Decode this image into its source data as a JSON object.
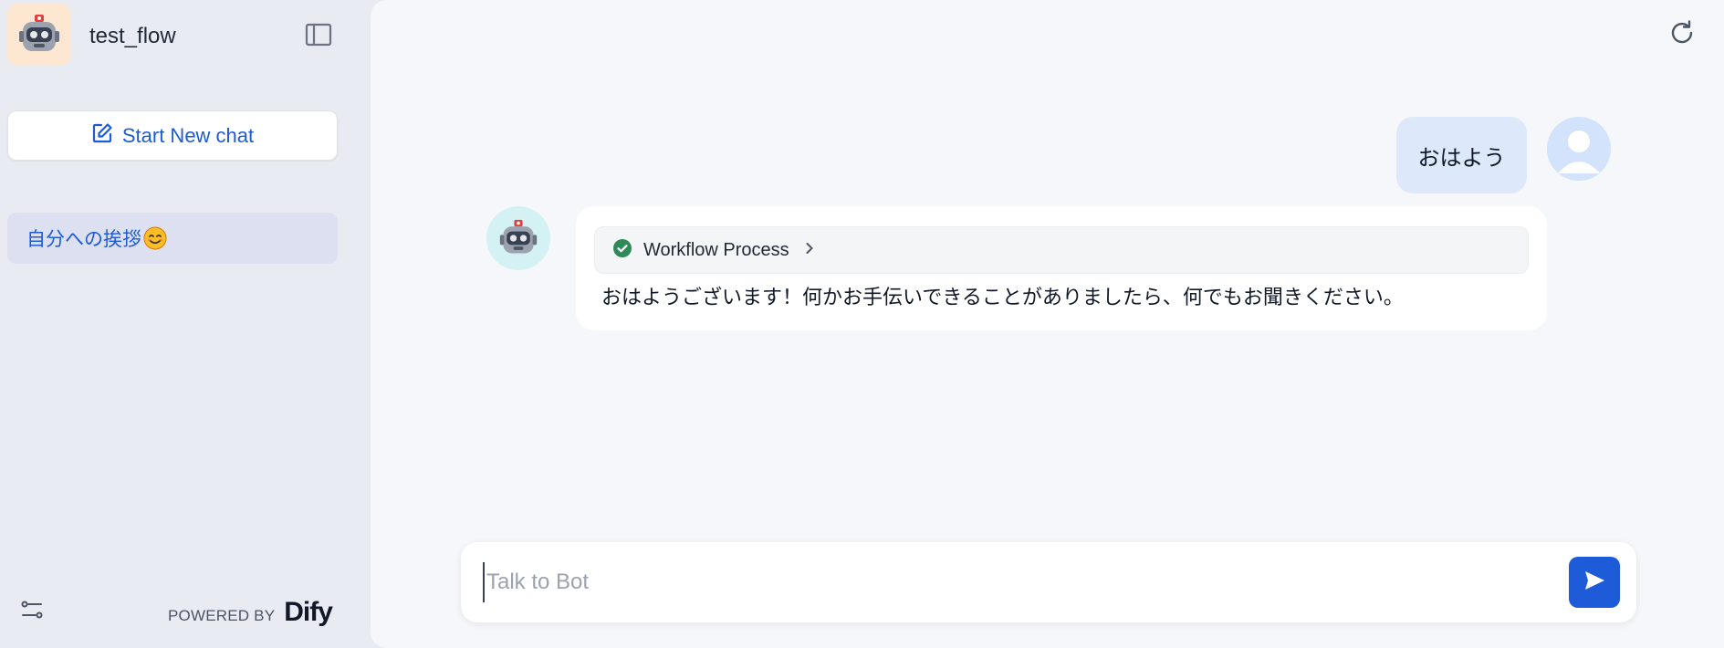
{
  "app": {
    "title": "test_flow",
    "icon": "robot-icon"
  },
  "sidebar": {
    "new_chat_label": "Start New chat",
    "conversations": [
      {
        "label": "自分への挨拶",
        "emoji": "smiling-face-icon",
        "active": true
      }
    ],
    "powered_by": "POWERED BY",
    "brand": "Dify"
  },
  "chat": {
    "messages": [
      {
        "role": "user",
        "text": "おはよう"
      },
      {
        "role": "bot",
        "workflow_label": "Workflow Process",
        "workflow_status": "success",
        "text": "おはようございます！何かお手伝いできることがありましたら、何でもお聞きください。"
      }
    ],
    "input_placeholder": "Talk to Bot"
  },
  "colors": {
    "accent": "#1d5bd8",
    "sidebar_bg": "#e9ebf2",
    "main_bg": "#f6f7fa",
    "user_bubble": "#dde8fb",
    "active_conversation": "#dce0f0",
    "success": "#2e8b57"
  }
}
